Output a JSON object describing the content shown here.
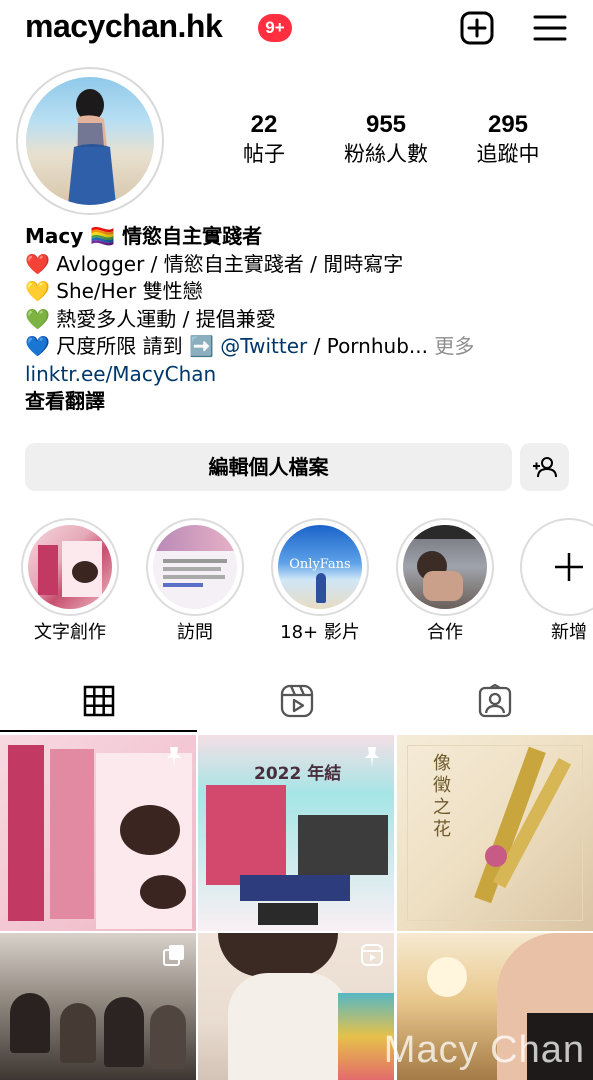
{
  "header": {
    "username": "macychan.hk",
    "notification_badge": "9+",
    "new_post_icon": "plus-square-icon",
    "menu_icon": "hamburger-menu-icon"
  },
  "profile": {
    "stats": [
      {
        "value": "22",
        "label": "帖子"
      },
      {
        "value": "955",
        "label": "粉絲人數"
      },
      {
        "value": "295",
        "label": "追蹤中"
      }
    ]
  },
  "bio": {
    "name": "Macy 🏳️‍🌈 情慾自主實踐者",
    "line1": "❤️ Avlogger / 情慾自主實踐者 / 閒時寫字",
    "line2": "💛 She/Her 雙性戀",
    "line3": "💚 熱愛多人運動 / 提倡兼愛",
    "line4_prefix": "💙 尺度所限 請到 ➡️ ",
    "line4_mention": "@Twitter",
    "line4_suffix": " / Pornhub... ",
    "more": "更多",
    "link": "linktr.ee/MacyChan",
    "translate": "查看翻譯"
  },
  "buttons": {
    "edit_profile": "編輯個人檔案",
    "add_person_icon": "add-person-icon"
  },
  "highlights": [
    {
      "label": "文字創作"
    },
    {
      "label": "訪問"
    },
    {
      "label": "18+ 影片",
      "overlay_text": "OnlyFans"
    },
    {
      "label": "合作"
    },
    {
      "label": "新增"
    }
  ],
  "tabs": [
    {
      "icon": "grid-icon",
      "active": true
    },
    {
      "icon": "reels-icon",
      "active": false
    },
    {
      "icon": "tagged-icon",
      "active": false
    }
  ],
  "grid": {
    "watermark": "Macy Chan",
    "posts": [
      {
        "tag_icon": "pin-icon"
      },
      {
        "title": "2022 年結",
        "tag_icon": "pin-icon"
      },
      {
        "title": "像徵之花"
      },
      {
        "tag_icon": "multi-image-icon"
      },
      {
        "tag_icon": "reels-icon"
      },
      {}
    ]
  },
  "colors": {
    "badge": "#ff2f40",
    "link": "#00376b",
    "muted": "#8e8e8e",
    "button_bg": "#efefef"
  }
}
